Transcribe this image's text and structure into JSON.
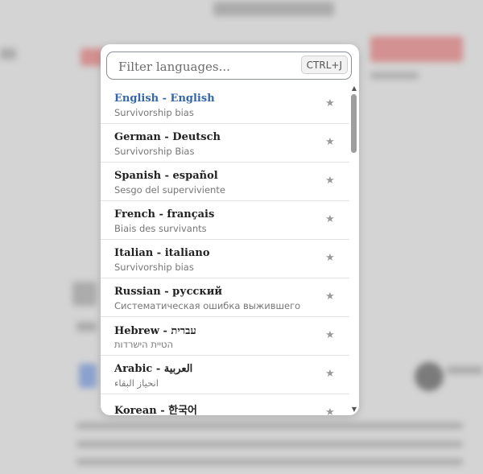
{
  "search": {
    "placeholder": "Filter languages...",
    "shortcut": "CTRL+J"
  },
  "languages": [
    {
      "title": "English - English",
      "subtitle": "Survivorship bias",
      "selected": true
    },
    {
      "title": "German - Deutsch",
      "subtitle": "Survivorship Bias"
    },
    {
      "title": "Spanish - español",
      "subtitle": "Sesgo del superviviente"
    },
    {
      "title": "French - français",
      "subtitle": "Biais des survivants"
    },
    {
      "title": "Italian - italiano",
      "subtitle": "Survivorship bias"
    },
    {
      "title": "Russian - русский",
      "subtitle": "Систематическая ошибка выжившего"
    },
    {
      "title": "Hebrew - עברית",
      "subtitle": "הטיית הישרדות"
    },
    {
      "title": "Arabic - العربية",
      "subtitle": "انحياز البقاء"
    },
    {
      "title": "Korean - 한국어",
      "subtitle": ""
    }
  ],
  "icons": {
    "favorite": "star-icon",
    "scroll_up": "arrow-up-icon",
    "scroll_down": "arrow-down-icon"
  },
  "colors": {
    "selected_title": "#3366aa",
    "backdrop": "#d4d4d4"
  }
}
